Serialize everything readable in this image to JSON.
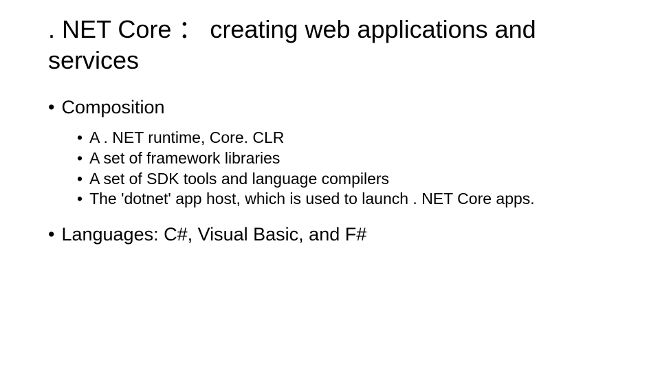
{
  "title": ". NET Core ： creating web applications and services",
  "bullets": {
    "composition": "Composition",
    "sub": [
      "A . NET runtime, Core. CLR",
      "A set of framework libraries",
      "A set of SDK tools and language compilers",
      "The 'dotnet' app host, which is used to launch . NET Core apps."
    ],
    "languages": "Languages: C#, Visual Basic, and F#"
  }
}
